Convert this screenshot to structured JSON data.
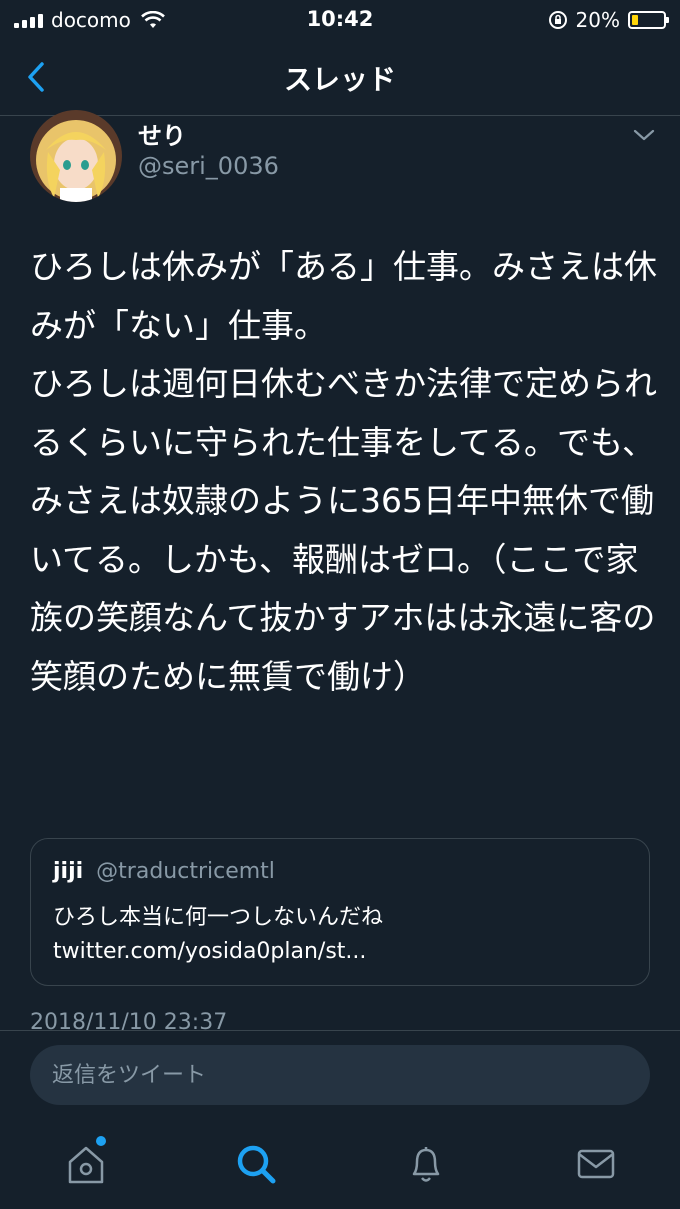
{
  "status_bar": {
    "carrier": "docomo",
    "time": "10:42",
    "battery_percent": "20%"
  },
  "nav": {
    "title": "スレッド"
  },
  "tweet": {
    "name": "せり",
    "handle": "@seri_0036",
    "text": "ひろしは休みが「ある」仕事。みさえは休みが「ない」仕事。\nひろしは週何日休むべきか法律で定められるくらいに守られた仕事をしてる。でも、みさえは奴隷のように365日年中無休で働いてる。しかも、報酬はゼロ。（ここで家族の笑顔なんて抜かすアホはは永遠に客の笑顔のために無賃で働け）",
    "quote": {
      "name": "jiji",
      "handle": "@traductricemtl",
      "text": "ひろし本当に何一つしないんだね twitter.com/yosida0plan/st..."
    },
    "timestamp": "2018/11/10 23:37"
  },
  "reply": {
    "placeholder": "返信をツイート"
  },
  "colors": {
    "background": "#15202b",
    "accent": "#1da1f2",
    "secondary_text": "#8899a6",
    "border": "#38444d"
  }
}
